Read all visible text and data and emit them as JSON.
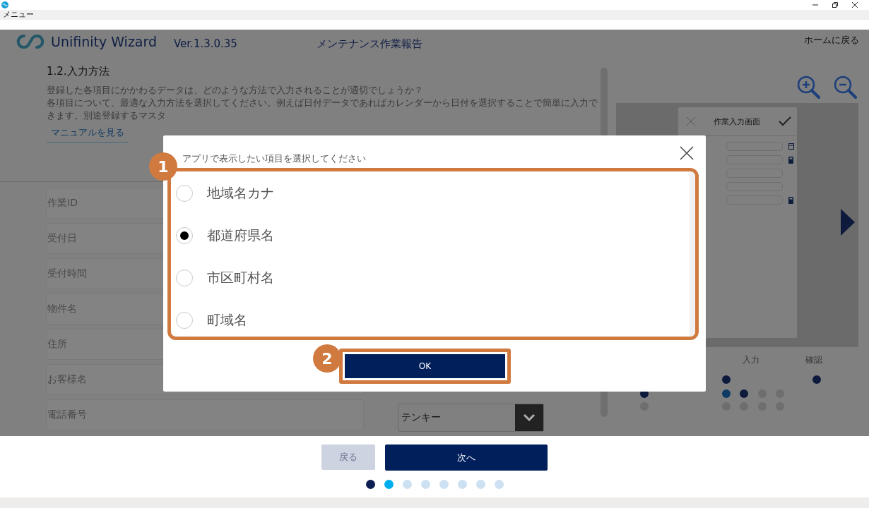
{
  "menu": {
    "label": "メニュー"
  },
  "header": {
    "app_name": "Unifinity Wizard",
    "version": "Ver.1.3.0.35",
    "title": "メンテナンス作業報告",
    "home_link": "ホームに戻る"
  },
  "guide": {
    "heading": "1.2.入力方法",
    "lines": [
      "登録した各項目にかかわるデータは、どのような方法で入力されることが適切でしょうか？",
      "各項目について、最適な入力方法を選択してください。例えば日付データであればカレンダーから日付を選択することで簡単に入力で",
      "きます。別途登録するマスタ"
    ],
    "manual_link": "マニュアルを見る"
  },
  "form": {
    "fields": [
      {
        "label": "作業ID"
      },
      {
        "label": "受付日"
      },
      {
        "label": "受付時間"
      },
      {
        "label": "物件名"
      },
      {
        "label": "住所"
      },
      {
        "label": "お客様名"
      },
      {
        "label": "電話番号",
        "input_type": "テンキー"
      }
    ]
  },
  "preview": {
    "screen_title": "作業入力画面"
  },
  "steps": [
    {
      "label": "入力"
    },
    {
      "label": "確認"
    }
  ],
  "dialog": {
    "title": "アプリで表示したい項目を選択してください",
    "options": [
      {
        "label": "地域名カナ",
        "selected": false
      },
      {
        "label": "都道府県名",
        "selected": true
      },
      {
        "label": "市区町村名",
        "selected": false
      },
      {
        "label": "町域名",
        "selected": false
      }
    ],
    "ok_button": "OK"
  },
  "annotations": [
    {
      "number": "1"
    },
    {
      "number": "2"
    }
  ],
  "navigation": {
    "back_button": {
      "label": "戻る",
      "disabled": true
    },
    "next_button": "次へ",
    "pages": [
      {
        "selected": false,
        "visited": true
      },
      {
        "selected": true,
        "visited": true
      },
      {
        "selected": false,
        "visited": false
      },
      {
        "selected": false,
        "visited": false
      },
      {
        "selected": false,
        "visited": false
      },
      {
        "selected": false,
        "visited": false
      },
      {
        "selected": false,
        "visited": false
      },
      {
        "selected": false,
        "visited": false
      }
    ]
  }
}
